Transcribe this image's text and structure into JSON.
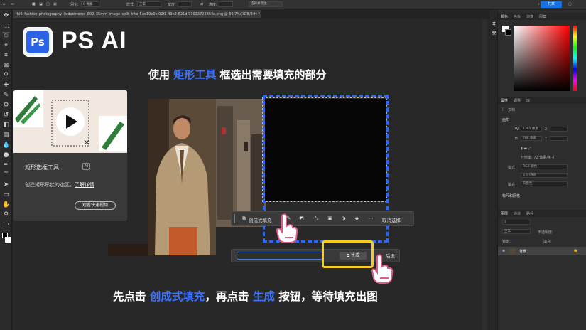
{
  "options_bar": {
    "feather_label": "羽化:",
    "feather_value": "0 像素",
    "style_label": "样式:",
    "style_value": "正常",
    "width_label": "宽度:",
    "height_label": "高度:",
    "select_mask_label": "选择并遮住...",
    "share_label": "共享"
  },
  "document_tab": {
    "title": "rhi6_fashion_photography_kodachrome_800_35mm_image_split_into_5ae10e9c-02f1-49e2-821d-91033723864c.png @ 66.7%(RGB/8#) *"
  },
  "overlay": {
    "logo_badge": "Ps",
    "logo_text": "PS AI",
    "heading_top_prefix": "使用",
    "heading_top_highlight": "矩形工具",
    "heading_top_suffix": "框选出需要填充的部分",
    "heading_bottom_part1": "先点击",
    "heading_bottom_highlight1": "创成式填充",
    "heading_bottom_part2": "，再点击",
    "heading_bottom_highlight2": "生成",
    "heading_bottom_part3": "按钮，等待填充出图",
    "highlight_color": "#3d72ff"
  },
  "tooltip": {
    "title": "矩形选框工具",
    "shortcut": "M",
    "desc_prefix": "创建矩形形状的选区。",
    "learn_more": "了解详情",
    "video_button": "观看快速视频"
  },
  "taskbar": {
    "generative_fill": "创成式填充",
    "cancel_selection": "取消选择"
  },
  "generate_bar": {
    "input_placeholder": "",
    "generate_button": "生成",
    "back_label": "后退"
  },
  "right_panel": {
    "color_tabs": [
      "颜色",
      "色板",
      "渐变",
      "图案"
    ],
    "props_tabs": [
      "属性",
      "调整",
      "库"
    ],
    "doc_label": "文档",
    "canvas_section": "画布",
    "w_label": "W",
    "w_value": "1365 像素",
    "x_label": "X",
    "h_label": "H",
    "h_value": "768 像素",
    "y_label": "Y",
    "resolution": "分辨率: 72 像素/英寸",
    "mode_label": "模式",
    "mode_value": "RGB 颜色",
    "depth_value": "8 位/通道",
    "fill_label": "填充",
    "fill_value": "背景色",
    "rulers_section": "标尺和网格",
    "layers_tabs": [
      "图层",
      "通道",
      "路径"
    ],
    "blend_mode": "正常",
    "opacity_label": "不透明度:",
    "lock_label": "锁定:",
    "fill2_label": "填充:",
    "layer_name": "背景"
  },
  "colors": {
    "accent_blue": "#2f66f2",
    "yellow_highlight": "#f6cc20",
    "share_blue": "#1473e6",
    "hand_pink": "#e05a86"
  }
}
